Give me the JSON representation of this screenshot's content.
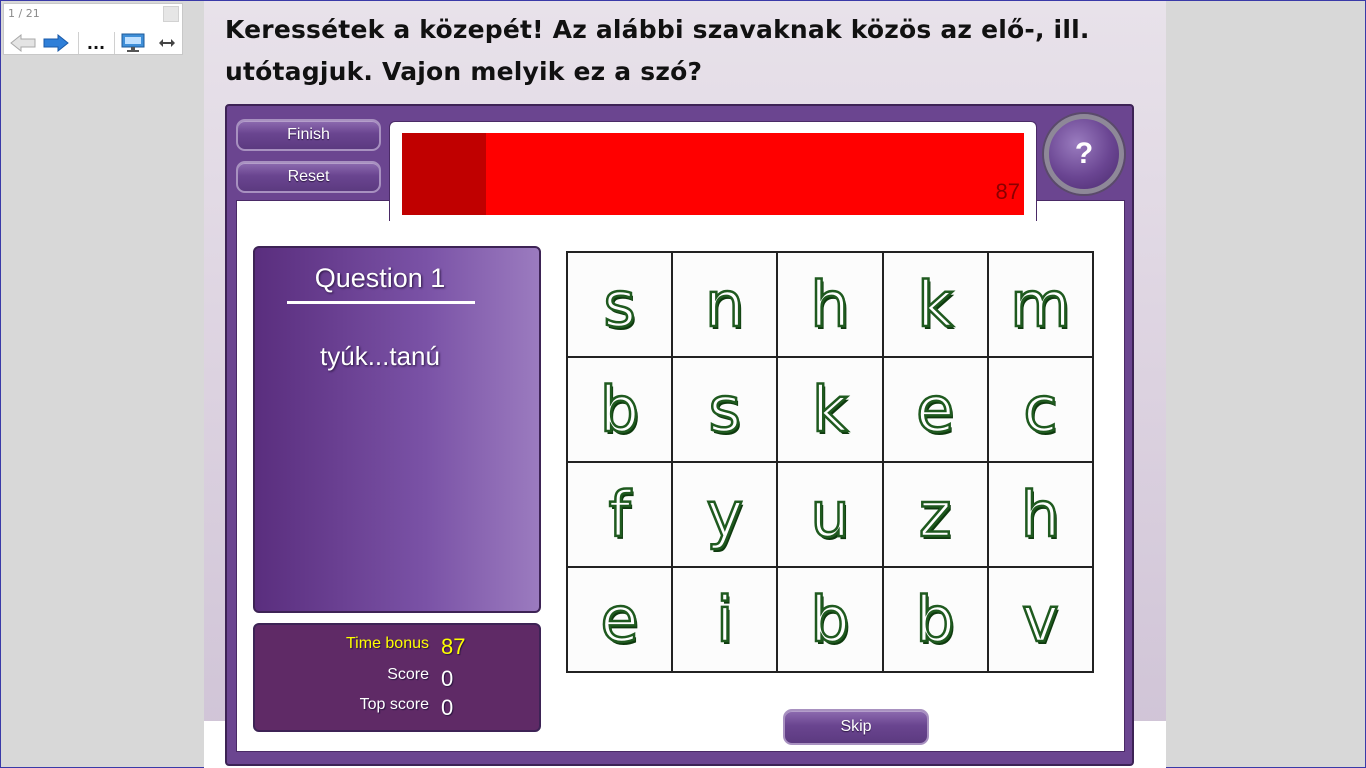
{
  "viewer": {
    "page_indicator": "1 / 21",
    "more_label": "..."
  },
  "slide": {
    "instruction": "Keressétek a közepét! Az alábbi szavaknak közös az elő-, ill. utótagjuk. Vajon melyik ez a szó?"
  },
  "game": {
    "finish_label": "Finish",
    "reset_label": "Reset",
    "skip_label": "Skip",
    "help_label": "?",
    "timer": {
      "value": "87",
      "remaining_fraction": 0.865
    },
    "question": {
      "title": "Question 1",
      "prompt": "tyúk...tanú"
    },
    "stats": {
      "time_bonus_label": "Time bonus",
      "time_bonus_value": "87",
      "score_label": "Score",
      "score_value": "0",
      "top_score_label": "Top score",
      "top_score_value": "0"
    },
    "letters": [
      "s",
      "n",
      "h",
      "k",
      "m",
      "b",
      "s",
      "k",
      "e",
      "c",
      "f",
      "y",
      "u",
      "z",
      "h",
      "e",
      "i",
      "b",
      "b",
      "v"
    ]
  },
  "colors": {
    "frame_purple": "#6b4590",
    "timer_red": "#ff0000",
    "timer_elapsed": "#c00000",
    "time_bonus_yellow": "#ffff00",
    "letter_outline_green": "#1f5a1f"
  }
}
